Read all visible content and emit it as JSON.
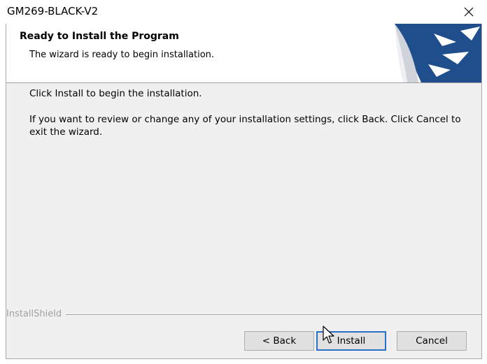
{
  "window": {
    "title": "GM269-BLACK-V2",
    "close_label": "×"
  },
  "header": {
    "title": "Ready to Install the Program",
    "subtitle": "The wizard is ready to begin installation."
  },
  "body": {
    "line1": "Click Install to begin the installation.",
    "line2": "If you want to review or change any of your installation settings, click Back. Click Cancel to exit the wizard."
  },
  "footer": {
    "brand": "InstallShield"
  },
  "buttons": {
    "back": "< Back",
    "install": "Install",
    "cancel": "Cancel"
  },
  "colors": {
    "logo_blue": "#1f4e8c",
    "focus_border": "#2a70c8"
  },
  "icons": {
    "close": "close-icon",
    "logo": "installshield-logo-icon",
    "cursor": "mouse-pointer-icon"
  }
}
